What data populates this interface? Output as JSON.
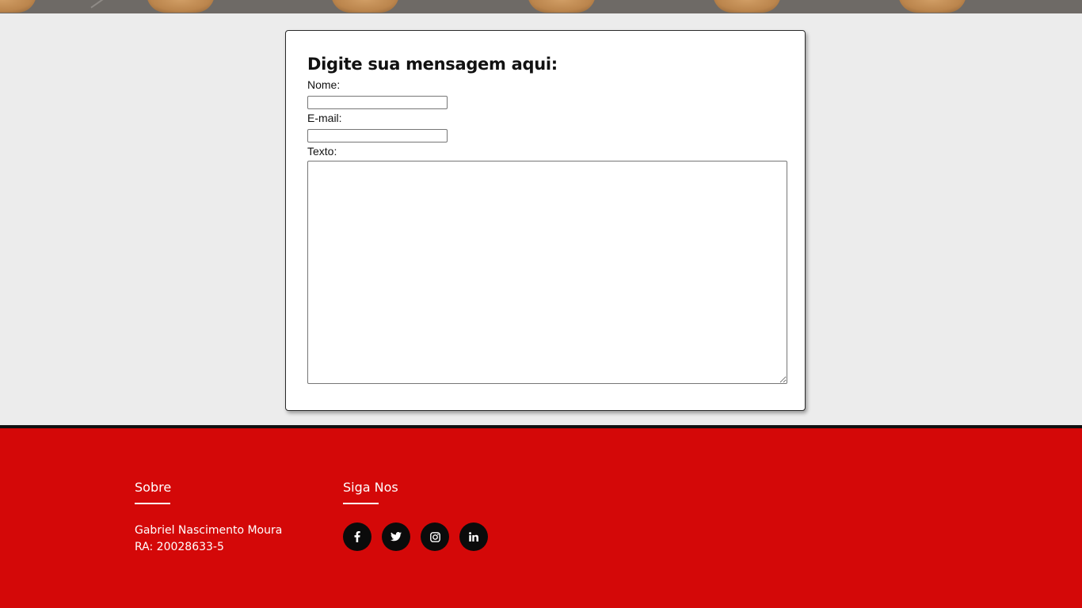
{
  "form": {
    "title": "Digite sua mensagem aqui:",
    "name_label": "Nome:",
    "name_value": "",
    "email_label": "E-mail:",
    "email_value": "",
    "text_label": "Texto:",
    "text_value": ""
  },
  "footer": {
    "about": {
      "heading": "Sobre",
      "name": "Gabriel Nascimento Moura",
      "ra": "RA: 20028633-5"
    },
    "social": {
      "heading": "Siga Nos",
      "icons": [
        "facebook-icon",
        "twitter-icon",
        "instagram-icon",
        "linkedin-icon"
      ]
    }
  },
  "colors": {
    "page_background": "#ececec",
    "footer_background": "#d40808",
    "social_button": "#0b0b0b"
  }
}
